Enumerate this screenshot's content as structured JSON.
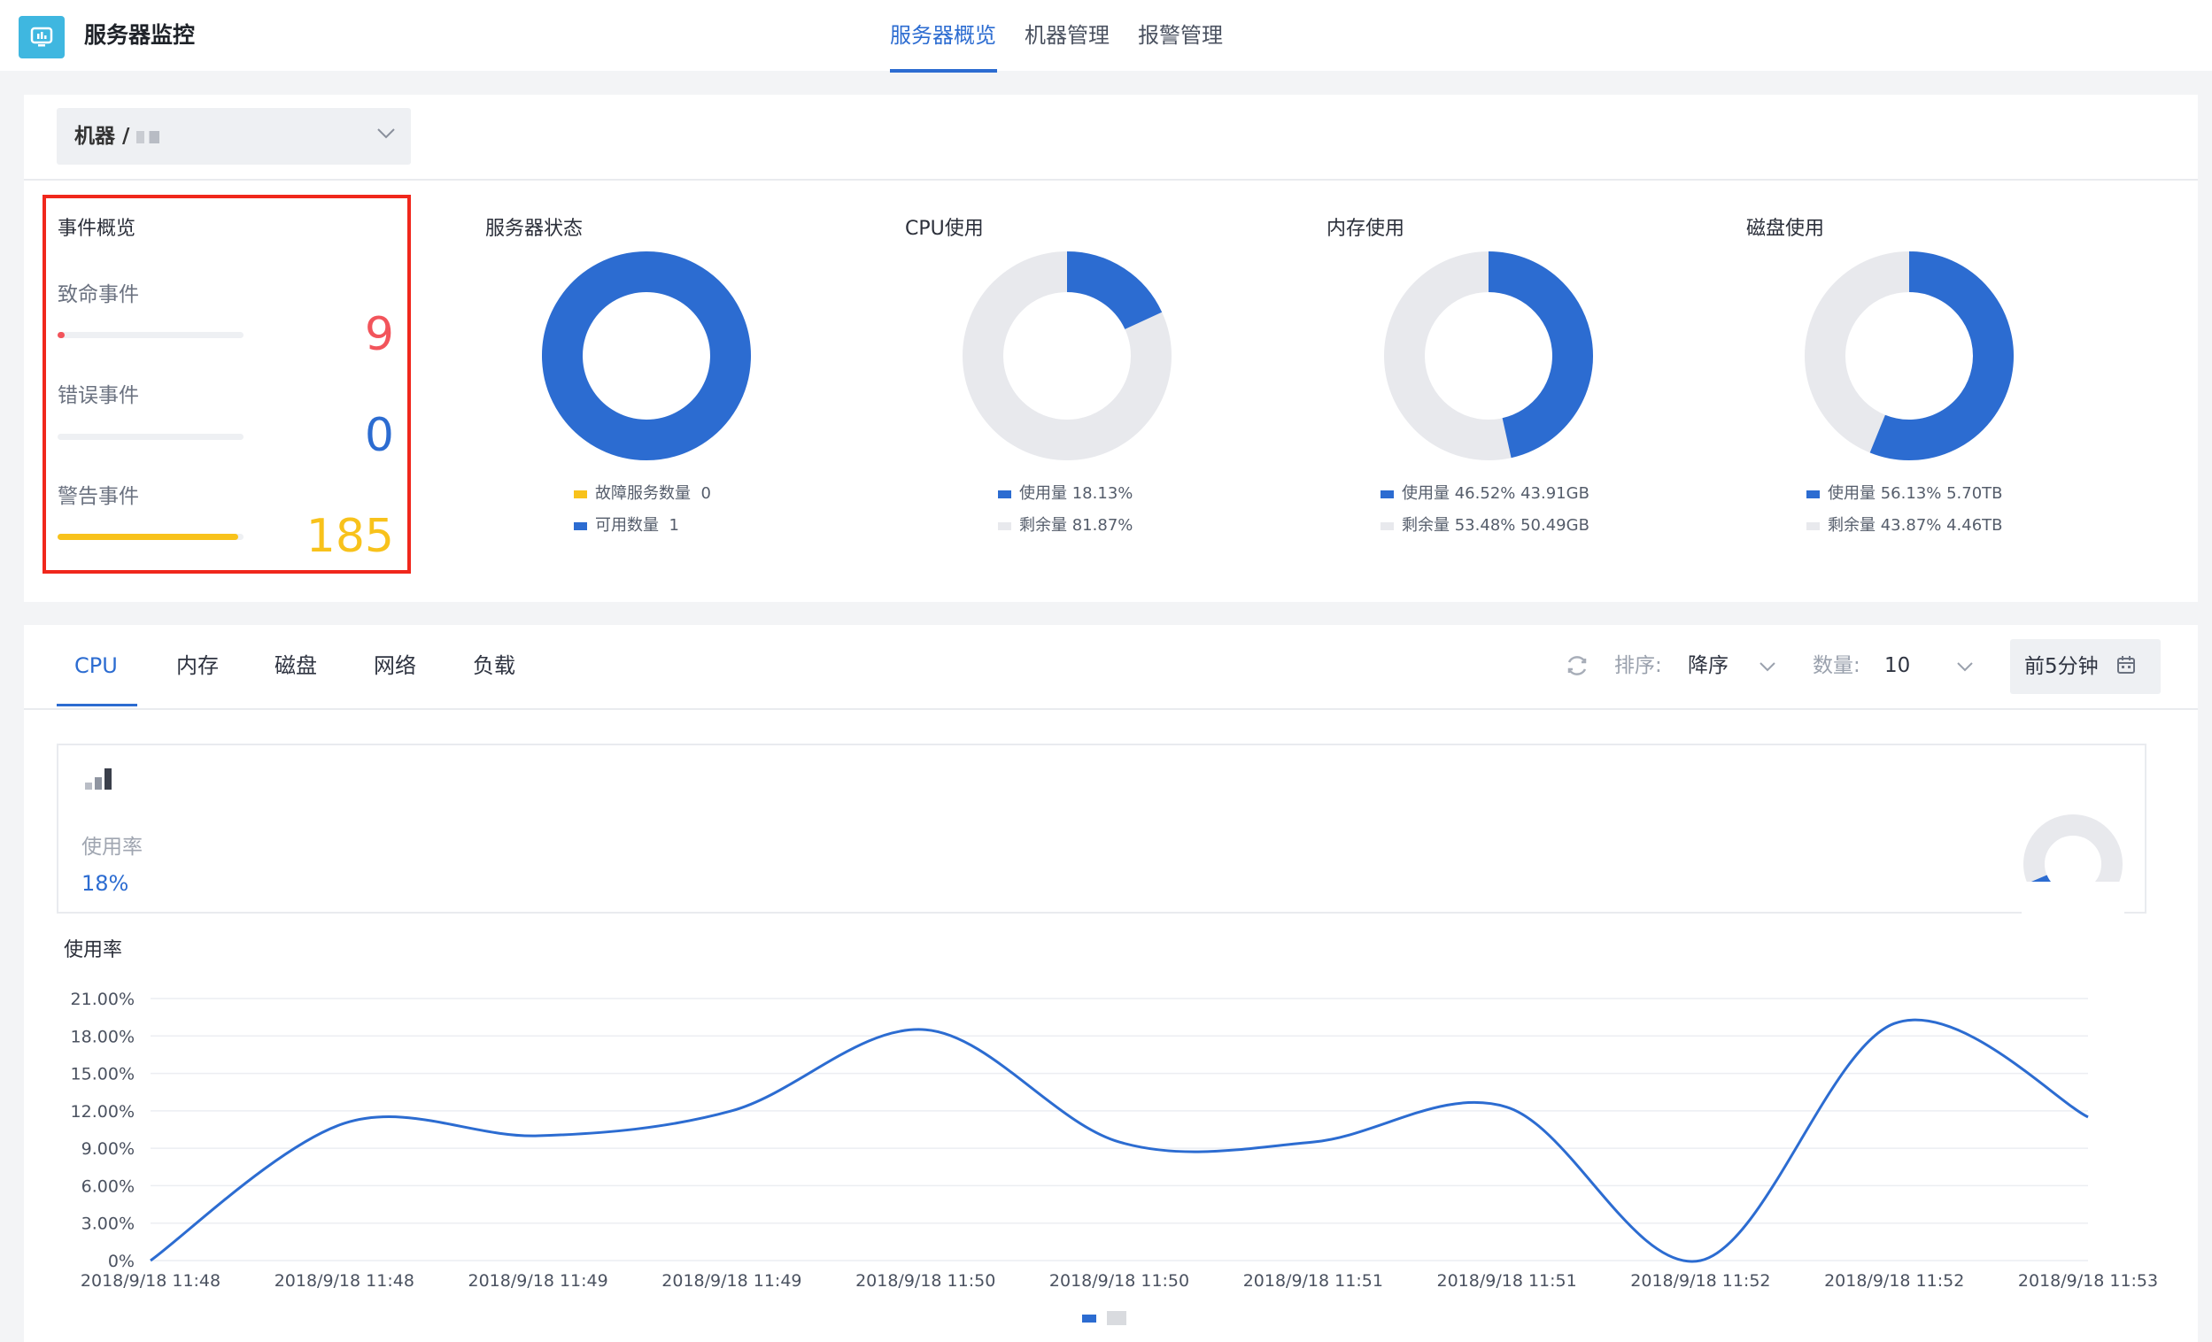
{
  "header": {
    "app_title": "服务器监控",
    "nav_tabs": [
      {
        "label": "服务器概览",
        "active": true
      },
      {
        "label": "机器管理",
        "active": false
      },
      {
        "label": "报警管理",
        "active": false
      }
    ]
  },
  "machine_select": {
    "label": "机器 / ",
    "icon": "chevron-down-icon"
  },
  "events": {
    "title": "事件概览",
    "items": [
      {
        "label": "致命事件",
        "count": "9",
        "color": "#f2545b",
        "fraction": 0.01
      },
      {
        "label": "错误事件",
        "count": "0",
        "color": "#2c6cd1",
        "fraction": 0
      },
      {
        "label": "警告事件",
        "count": "185",
        "color": "#f8c21b",
        "fraction": 0.97
      }
    ]
  },
  "donuts": [
    {
      "title": "服务器状态",
      "used_fraction": 1.0,
      "legend": [
        {
          "label": "故障服务数量",
          "value": "0",
          "color": "#f8c21b"
        },
        {
          "label": "可用数量",
          "value": "1",
          "color": "#2c6cd1"
        }
      ]
    },
    {
      "title": "CPU使用",
      "used_fraction": 0.1813,
      "legend": [
        {
          "label": "使用量",
          "value": "18.13%",
          "color": "#2c6cd1"
        },
        {
          "label": "剩余量",
          "value": "81.87%",
          "color": "#e8e9ed"
        }
      ]
    },
    {
      "title": "内存使用",
      "used_fraction": 0.4652,
      "legend": [
        {
          "label": "使用量",
          "value": "46.52% 43.91GB",
          "color": "#2c6cd1"
        },
        {
          "label": "剩余量",
          "value": "53.48% 50.49GB",
          "color": "#e8e9ed"
        }
      ]
    },
    {
      "title": "磁盘使用",
      "used_fraction": 0.5613,
      "legend": [
        {
          "label": "使用量",
          "value": "56.13% 5.70TB",
          "color": "#2c6cd1"
        },
        {
          "label": "剩余量",
          "value": "43.87% 4.46TB",
          "color": "#e8e9ed"
        }
      ]
    }
  ],
  "metric_tabs": [
    {
      "label": "CPU",
      "active": true
    },
    {
      "label": "内存",
      "active": false
    },
    {
      "label": "磁盘",
      "active": false
    },
    {
      "label": "网络",
      "active": false
    },
    {
      "label": "负载",
      "active": false
    }
  ],
  "controls": {
    "refresh_icon": "refresh-icon",
    "sort_label": "排序:",
    "sort_value": "降序",
    "count_label": "数量:",
    "count_value": "10",
    "time_range": "前5分钟",
    "calendar_icon": "calendar-icon"
  },
  "summary": {
    "bar_icon": "bar-chart-icon",
    "label": "使用率",
    "value": "18%",
    "gauge_fraction": 0.18
  },
  "chart_data": {
    "type": "line",
    "title": "使用率",
    "x": [
      "2018/9/18 11:48",
      "2018/9/18 11:48",
      "2018/9/18 11:49",
      "2018/9/18 11:49",
      "2018/9/18 11:50",
      "2018/9/18 11:50",
      "2018/9/18 11:51",
      "2018/9/18 11:51",
      "2018/9/18 11:52",
      "2018/9/18 11:52",
      "2018/9/18 11:53"
    ],
    "series": [
      {
        "name": "",
        "values": [
          0.0,
          11.0,
          10.0,
          12.0,
          18.5,
          9.5,
          9.5,
          12.3,
          0.0,
          19.0,
          11.5
        ]
      }
    ],
    "yticks": [
      "21.00%",
      "18.00%",
      "15.00%",
      "12.00%",
      "9.00%",
      "6.00%",
      "3.00%",
      "0%"
    ],
    "ylim": [
      0,
      21
    ],
    "grid": true,
    "color": "#2c6cd1"
  }
}
